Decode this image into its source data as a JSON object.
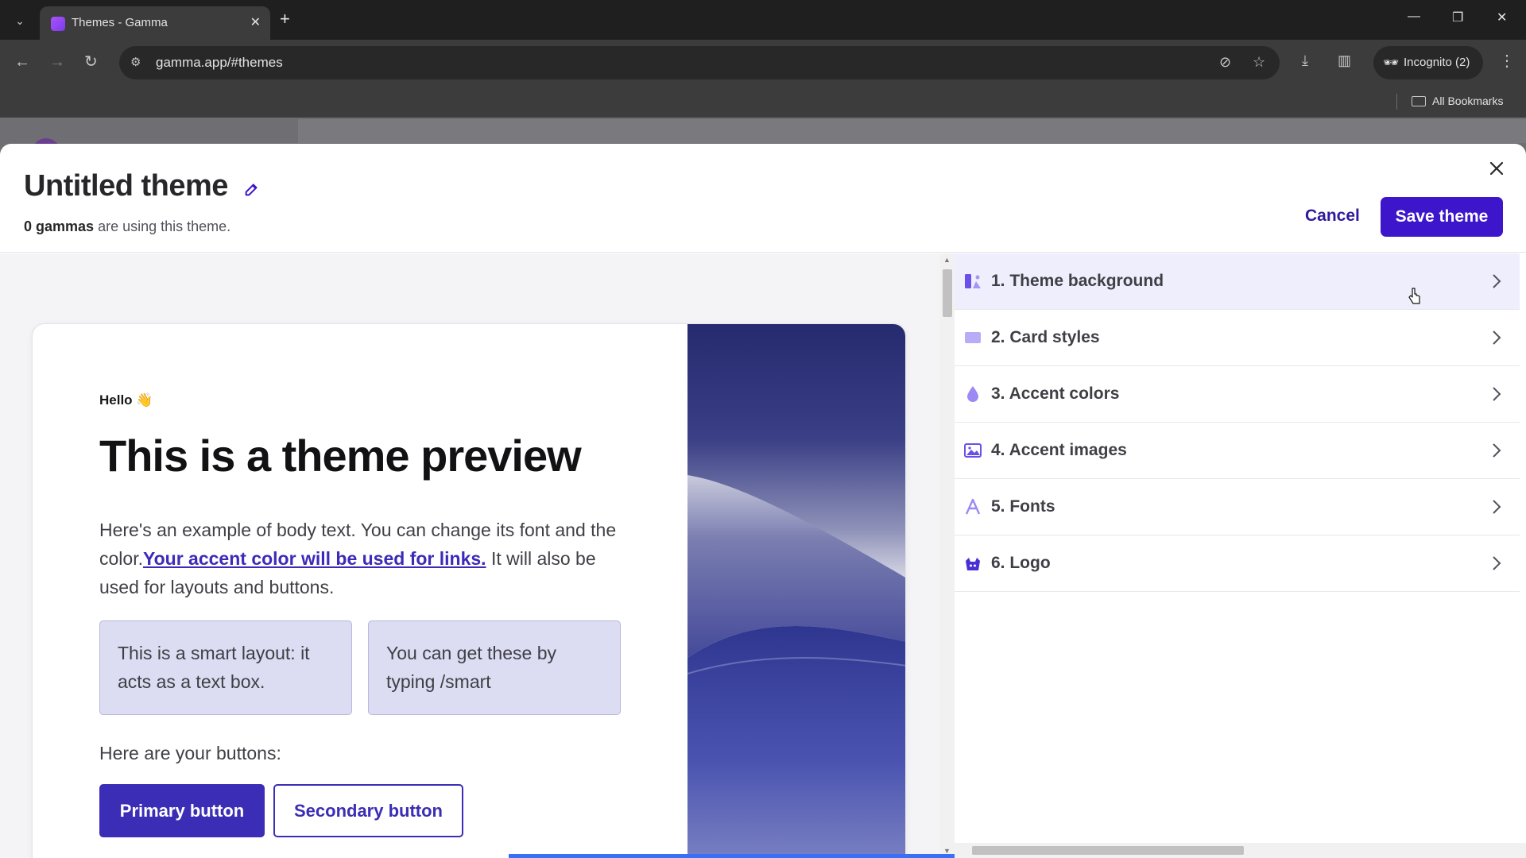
{
  "browser": {
    "tab_title": "Themes - Gamma",
    "url": "gamma.app/#themes",
    "incognito_label": "Incognito (2)",
    "bookmarks_label": "All Bookmarks"
  },
  "modal": {
    "title": "Untitled theme",
    "usage_count": "0 gammas",
    "usage_suffix": " are using this theme.",
    "cancel_label": "Cancel",
    "save_label": "Save theme"
  },
  "preview": {
    "hello": "Hello",
    "hello_emoji": "👋",
    "heading": "This is a theme preview",
    "body_before": "Here's an example of body text. You can change its font and the color.",
    "body_link": "Your accent color will be used for links.",
    "body_after": " It will also be used for layouts and buttons.",
    "smart_left": "This is a smart layout: it acts as a text box.",
    "smart_right": "You can get these by typing /smart",
    "buttons_label": "Here are your buttons:",
    "primary_label": "Primary button",
    "secondary_label": "Secondary button"
  },
  "settings": {
    "items": [
      {
        "label": "1. Theme background",
        "icon": "theme-background-icon",
        "active": true
      },
      {
        "label": "2. Card styles",
        "icon": "card-styles-icon",
        "active": false
      },
      {
        "label": "3. Accent colors",
        "icon": "accent-colors-icon",
        "active": false
      },
      {
        "label": "4. Accent images",
        "icon": "accent-images-icon",
        "active": false
      },
      {
        "label": "5. Fonts",
        "icon": "fonts-icon",
        "active": false
      },
      {
        "label": "6. Logo",
        "icon": "logo-icon",
        "active": false
      }
    ]
  },
  "colors": {
    "brand": "#3d16cc",
    "accent": "#3b2db5",
    "icon": "#7b63f0"
  }
}
